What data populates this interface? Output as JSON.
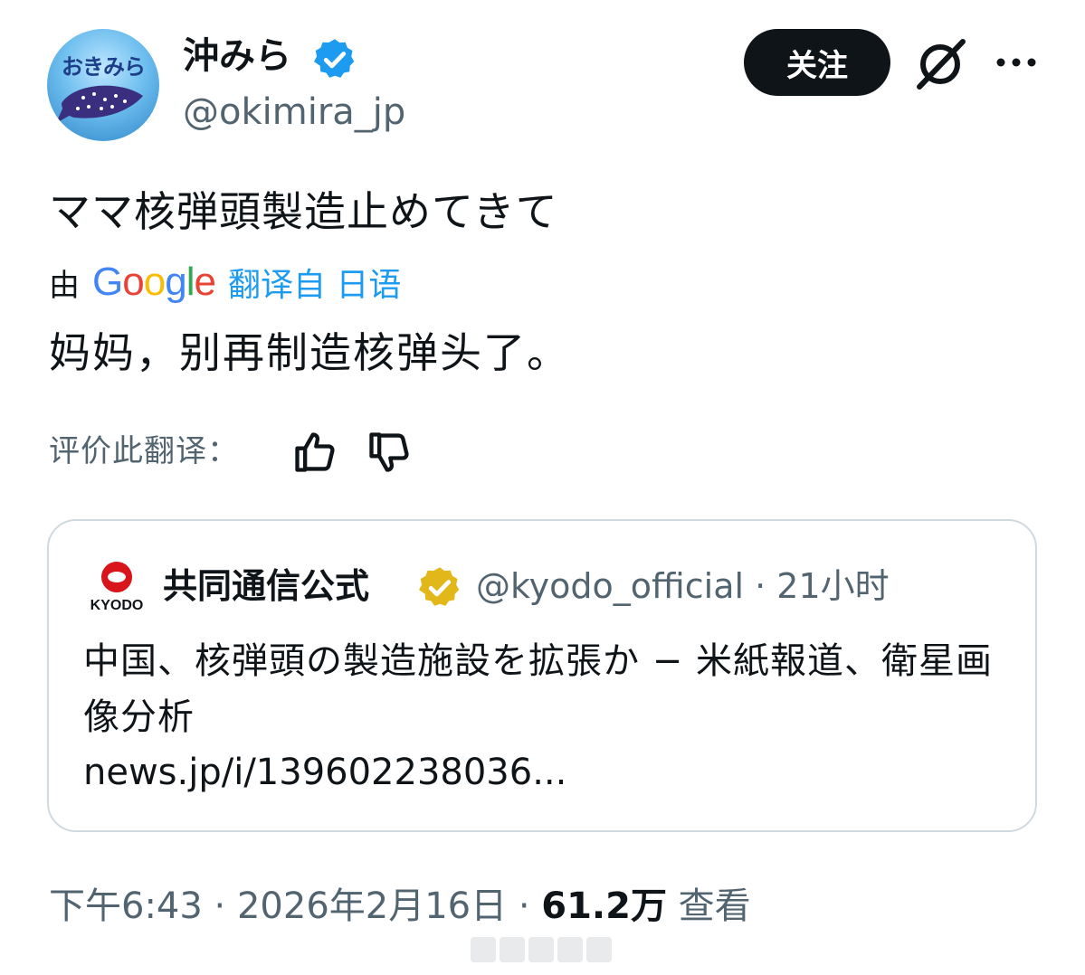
{
  "author": {
    "avatar_text": "おきみら",
    "display_name": "沖みら",
    "handle": "@okimira_jp"
  },
  "actions": {
    "follow_label": "关注",
    "grok_icon": "grok-icon",
    "more_icon": "more-icon"
  },
  "tweet": {
    "text": "ママ核弾頭製造止めてきて",
    "translated_prefix": "由",
    "translator_name": "Google",
    "translate_link": "翻译自 日语",
    "translated_text": "妈妈，别再制造核弹头了。",
    "rate_label": "评价此翻译："
  },
  "quote": {
    "logo_text": "KYODO",
    "name": "共同通信公式",
    "handle_time": "@kyodo_official · 21小时",
    "text": "中国、核弾頭の製造施設を拡張か − 米紙報道、衛星画像分析",
    "link": "news.jp/i/139602238036..."
  },
  "meta": {
    "time_date": "下午6:43 · 2026年2月16日 · ",
    "views_count": "61.2万",
    "views_label": " 查看"
  },
  "colors": {
    "accent": "#1d9bf0",
    "verified": "#1d9bf0",
    "gold_verified": "#e2b719",
    "text_primary": "#0f1419",
    "text_secondary": "#536471",
    "border": "#cfd9de"
  }
}
